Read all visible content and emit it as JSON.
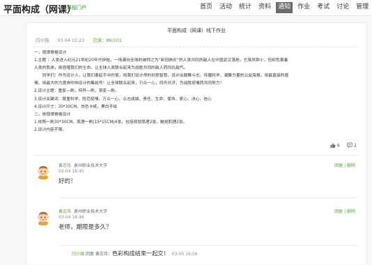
{
  "header": {
    "site_title": "平面构成（网课）",
    "portal_link": "课程门户",
    "nav": [
      "首页",
      "活动",
      "统计",
      "资料",
      "通知",
      "作业",
      "考试",
      "讨论",
      "管理"
    ],
    "active_nav": "通知"
  },
  "post": {
    "title": "平面构成（网课）线下作业",
    "author": "闫小强",
    "time": "03-04 15:23",
    "stats": "已读：86/101",
    "body": [
      "一，视律脊格设计",
      "1.主题 ：人类进入纪元21世纪20年代伊始，一场袭向全球的被称之为“新冠肺炎”的人类共同的敌人在中国武汉落地，它虽然渺小，但却危害着",
      "人类的肌体，欲吞噬我们的生命。让全球人类联合起来为战胜共同的敌人而同仇敌忾。",
      "　　同学们：作为设计人，让我们拿起手中的笔，用我们设计师的创意智慧，设计出鼓舞斗志、传播科学、凝聚力量的公益海报。用最直接的感",
      "情、用最大的力度去吹响设计的集结号！让全球联合起来，万众一心，同舟共济，为战胜疫情而共同努力！",
      "2.设计主题：重复—刷，特异—刷，渐变—刷。",
      "3.设计关键词：尊重科学、防范疫情、万众一心、众志成城、责任、生命、使命、爱心、决心、信心",
      "4.设计尺寸：30*30CM，白色卡纸，黑白手绘",
      "二，依规律脊格设计",
      "1.依照一刷30*30CM，肌理一刷(15*15CM)4张，包括视觉肌理2张，触觉肌理2张。",
      "2.设计内容不限。"
    ],
    "likes": "6",
    "comments": "2"
  },
  "replies": [
    {
      "name": "黄志伟",
      "org": "泉州职业技术大学",
      "time": "03-04 18:45",
      "content": "好的！",
      "actions": "回复 | 删除"
    },
    {
      "name": "黄志伟",
      "org": "泉州职业技术大学",
      "time": "03-04 18:46",
      "content": "老师，期限是多久？",
      "actions": "回复 | 删除"
    }
  ],
  "sub_reply": {
    "name": "闫小强",
    "reply_word": "回复",
    "target": "黄志伟：",
    "content": "色彩构成结束一起交！",
    "time": "03-05 16:56"
  },
  "colors": {
    "accent": "#5a9e3a",
    "nav_active": "#6a6a6a"
  }
}
